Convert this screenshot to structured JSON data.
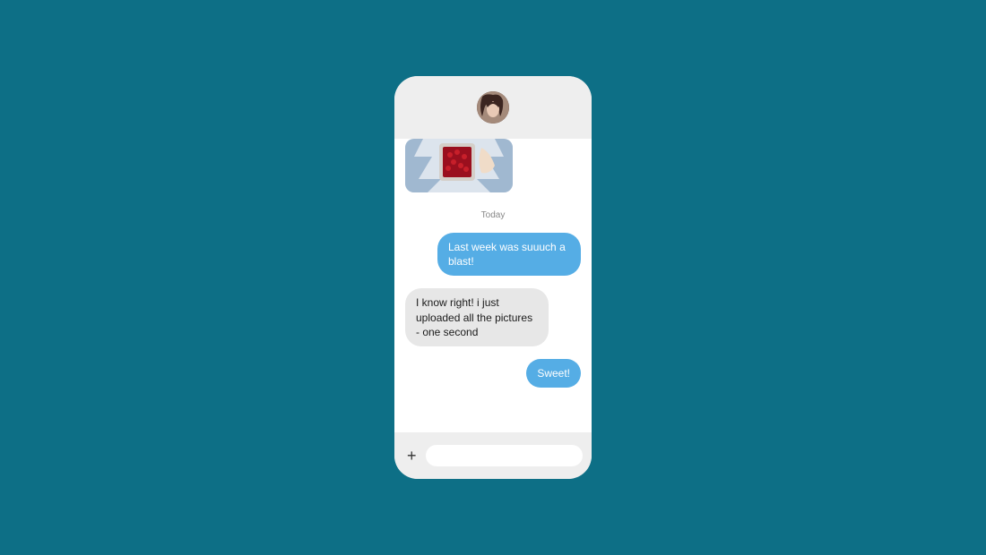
{
  "colors": {
    "background": "#0d6f86",
    "phone_body": "#eeeeee",
    "chat_area": "#ffffff",
    "outgoing_bubble": "#55ade5",
    "incoming_bubble": "#e7e7e7"
  },
  "header": {
    "avatar_alt": "contact-avatar"
  },
  "chat": {
    "day_label": "Today",
    "messages": [
      {
        "direction": "outgoing",
        "text": "Last week was suuuch a blast!"
      },
      {
        "direction": "incoming",
        "text": "I know right! i just uploaded all the pictures - one second"
      },
      {
        "direction": "outgoing",
        "text": "Sweet!"
      }
    ]
  },
  "composer": {
    "attach_label": "+",
    "input_value": "",
    "input_placeholder": ""
  }
}
